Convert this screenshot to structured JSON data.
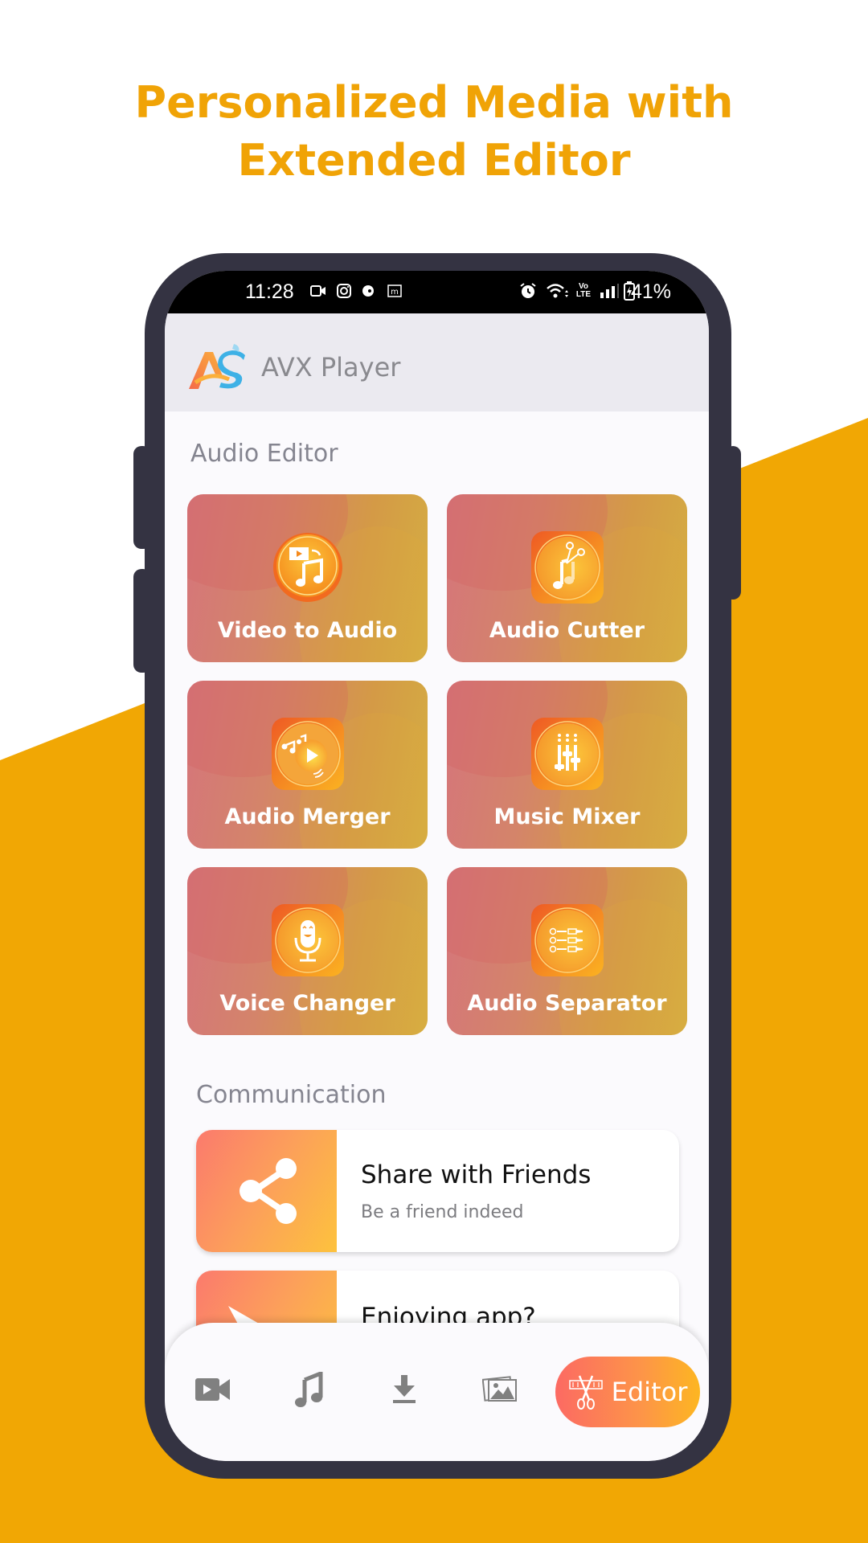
{
  "headline": {
    "line1": "Personalized Media with",
    "line2": "Extended Editor"
  },
  "colors": {
    "accent": "#f1a704",
    "phone_frame": "#343342",
    "tile_gradient_start": "#d5757b",
    "tile_gradient_end": "#d5ae42",
    "nav_active_start": "#fc6a63",
    "nav_active_end": "#fdb621"
  },
  "status_bar": {
    "time": "11:28",
    "left_icons": [
      "video-call-icon",
      "instagram-icon",
      "app-notification-icon",
      "m-app-icon"
    ],
    "right_icons": [
      "alarm-icon",
      "wifi-icon",
      "volte-icon",
      "signal-icon",
      "battery-charging-icon"
    ],
    "volte_label_top": "Vo",
    "volte_label_bottom": "LTE",
    "battery": "41%"
  },
  "app_header": {
    "logo": "AS",
    "title": "AVX Player"
  },
  "audio_editor": {
    "section_title": "Audio Editor",
    "tiles": [
      {
        "label": "Video to Audio",
        "icon": "video-to-audio-icon"
      },
      {
        "label": "Audio Cutter",
        "icon": "audio-cutter-icon"
      },
      {
        "label": "Audio Merger",
        "icon": "audio-merger-icon"
      },
      {
        "label": "Music Mixer",
        "icon": "music-mixer-icon"
      },
      {
        "label": "Voice Changer",
        "icon": "voice-changer-icon"
      },
      {
        "label": "Audio Separator",
        "icon": "audio-separator-icon"
      }
    ]
  },
  "communication": {
    "section_title": "Communication",
    "cards": [
      {
        "title": "Share with Friends",
        "subtitle": "Be a friend indeed",
        "icon": "share-icon"
      },
      {
        "title": "Enjoying app?",
        "subtitle": "",
        "icon": "send-icon"
      }
    ]
  },
  "bottom_nav": {
    "items": [
      {
        "name": "videos",
        "icon": "video-icon"
      },
      {
        "name": "music",
        "icon": "music-note-icon"
      },
      {
        "name": "downloads",
        "icon": "download-icon"
      },
      {
        "name": "photos",
        "icon": "gallery-icon"
      },
      {
        "name": "editor",
        "icon": "scissors-film-icon",
        "label": "Editor",
        "active": true
      }
    ]
  }
}
